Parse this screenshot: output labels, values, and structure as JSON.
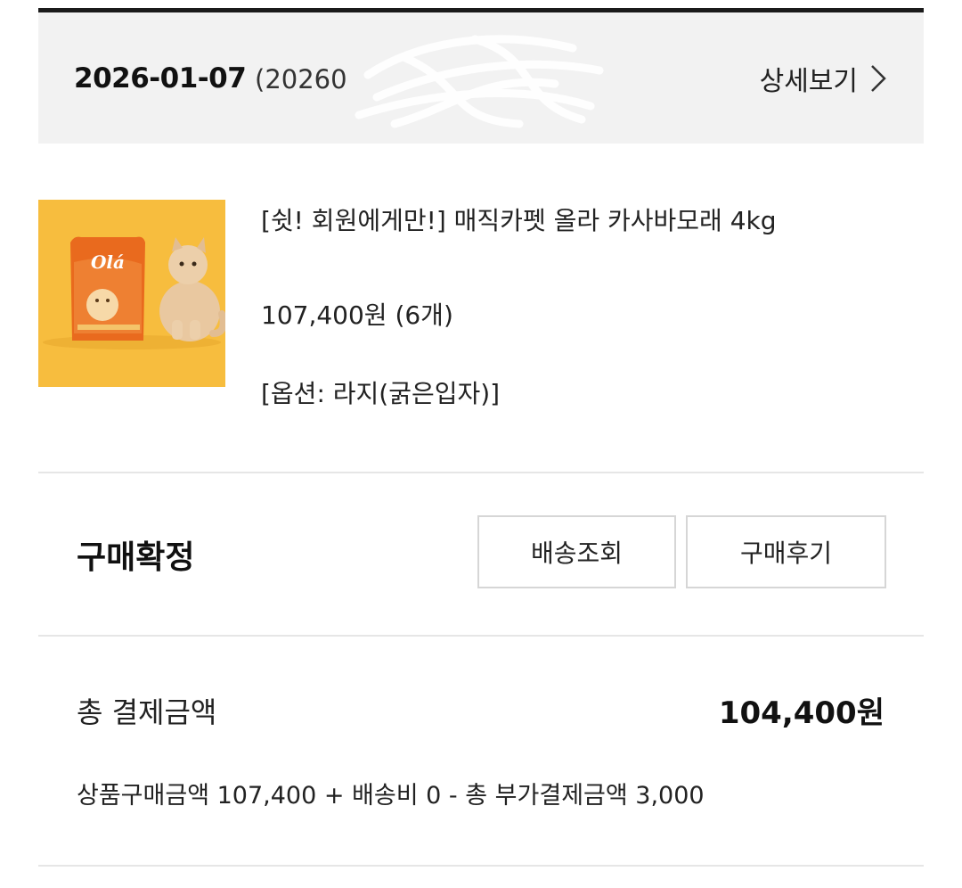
{
  "order": {
    "date": "2026-01-07",
    "order_number": "(20260",
    "detail_label": "상세보기"
  },
  "product": {
    "name": "[쉿! 회원에게만!] 매직카펫 올라 카사바모래 4kg",
    "price_qty": "107,400원 (6개)",
    "option": "[옵션: 라지(굵은입자)]",
    "image_brand_text": "Olá"
  },
  "status": {
    "label": "구매확정",
    "buttons": {
      "tracking": "배송조회",
      "review": "구매후기"
    }
  },
  "payment": {
    "total_label": "총 결제금액",
    "total_amount": "104,400원",
    "breakdown": "상품구매금액 107,400 + 배송비 0 - 총 부가결제금액 3,000"
  },
  "colors": {
    "header_bg": "#f2f2f2",
    "thumb_bg": "#f7bd3e",
    "bag": "#e96a1e"
  }
}
